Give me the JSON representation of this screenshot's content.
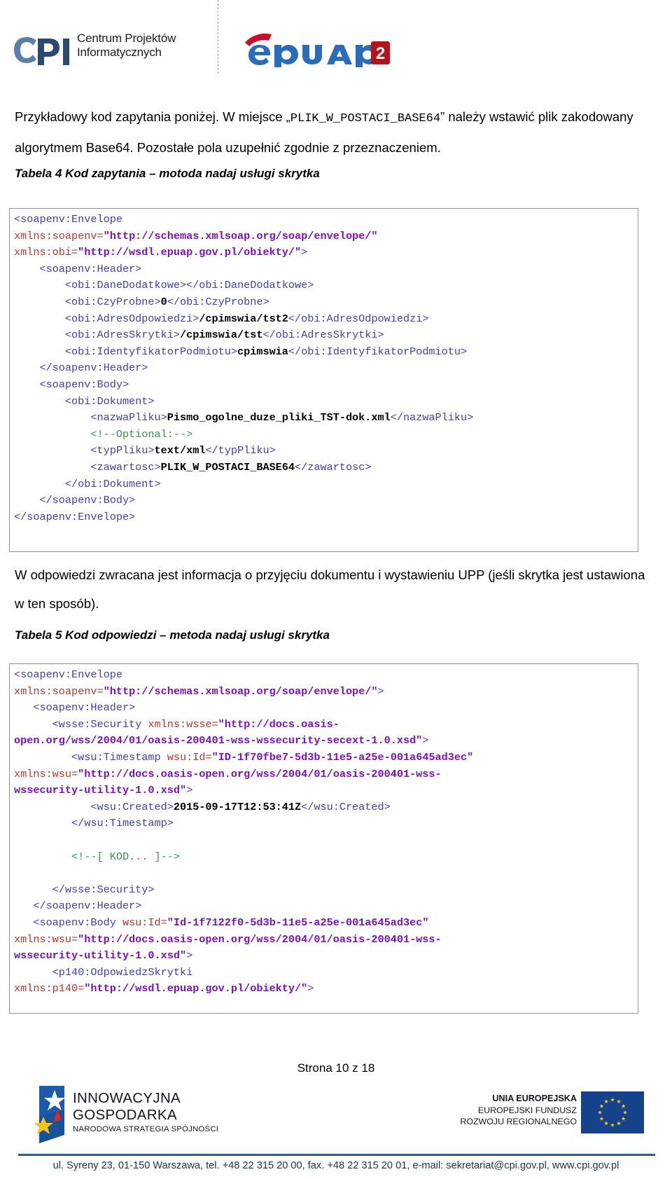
{
  "header": {
    "cpi_logo_line1": "Centrum Projektów",
    "cpi_logo_line2": "Informatycznych",
    "cpi_mark_text": "CPI",
    "epuap_wordmark": "ePUAP",
    "epuap_badge": "2"
  },
  "intro": {
    "part1": "Przykładowy kod zapytania poniżej. W miejsce „",
    "code": "PLIK_W_POSTACI_BASE64",
    "part2": "” należy wstawić plik zakodowany algorytmem Base64. Pozostałe pola uzupełnić zgodnie z przeznaczeniem."
  },
  "caption_tabela4": "Tabela 4 Kod zapytania – motoda nadaj usługi skrytka",
  "caption_tabela5": "Tabela 5 Kod odpowiedzi – metoda nadaj usługi skrytka",
  "mid_para": "W odpowiedzi zwracana jest informacja o przyjęciu dokumentu i wystawieniu UPP (jeśli skrytka jest ustawiona w ten sposób).",
  "code_request": {
    "lines": [
      [
        [
          "tag",
          "<soapenv:Envelope"
        ]
      ],
      [
        [
          "attr",
          "xmlns:soapenv="
        ],
        [
          "val",
          "\"http://schemas.xmlsoap.org/soap/envelope/\""
        ]
      ],
      [
        [
          "attr",
          "xmlns:obi="
        ],
        [
          "val",
          "\"http://wsdl.epuap.gov.pl/obiekty/\""
        ],
        [
          "tag",
          ">"
        ]
      ],
      [
        [
          "tag",
          "    <soapenv:Header>"
        ]
      ],
      [
        [
          "tag",
          "        <obi:DaneDodatkowe></obi:DaneDodatkowe>"
        ]
      ],
      [
        [
          "tag",
          "        <obi:CzyProbne>"
        ],
        [
          "text",
          "0"
        ],
        [
          "tag",
          "</obi:CzyProbne>"
        ]
      ],
      [
        [
          "tag",
          "        <obi:AdresOdpowiedzi>"
        ],
        [
          "text",
          "/cpimswia/tst2"
        ],
        [
          "tag",
          "</obi:AdresOdpowiedzi>"
        ]
      ],
      [
        [
          "tag",
          "        <obi:AdresSkrytki>"
        ],
        [
          "text",
          "/cpimswia/tst"
        ],
        [
          "tag",
          "</obi:AdresSkrytki>"
        ]
      ],
      [
        [
          "tag",
          "        <obi:IdentyfikatorPodmiotu>"
        ],
        [
          "text",
          "cpimswia"
        ],
        [
          "tag",
          "</obi:IdentyfikatorPodmiotu>"
        ]
      ],
      [
        [
          "tag",
          "    </soapenv:Header>"
        ]
      ],
      [
        [
          "tag",
          "    <soapenv:Body>"
        ]
      ],
      [
        [
          "tag",
          "        <obi:Dokument>"
        ]
      ],
      [
        [
          "tag",
          "            <nazwaPliku>"
        ],
        [
          "text",
          "Pismo_ogolne_duze_pliki_TST-dok.xml"
        ],
        [
          "tag",
          "</nazwaPliku>"
        ]
      ],
      [
        [
          "cmt",
          "            <!--Optional:-->"
        ]
      ],
      [
        [
          "tag",
          "            <typPliku>"
        ],
        [
          "text",
          "text/xml"
        ],
        [
          "tag",
          "</typPliku>"
        ]
      ],
      [
        [
          "tag",
          "            <zawartosc>"
        ],
        [
          "text",
          "PLIK_W_POSTACI_BASE64"
        ],
        [
          "tag",
          "</zawartosc>"
        ]
      ],
      [
        [
          "tag",
          "        </obi:Dokument>"
        ]
      ],
      [
        [
          "tag",
          "    </soapenv:Body>"
        ]
      ],
      [
        [
          "tag",
          "</soapenv:Envelope>"
        ]
      ]
    ]
  },
  "code_response": {
    "lines": [
      [
        [
          "tag",
          "<soapenv:Envelope"
        ]
      ],
      [
        [
          "attr",
          "xmlns:soapenv="
        ],
        [
          "val",
          "\"http://schemas.xmlsoap.org/soap/envelope/\""
        ],
        [
          "tag",
          ">"
        ]
      ],
      [
        [
          "tag",
          "   <soapenv:Header>"
        ]
      ],
      [
        [
          "tag",
          "      <wsse:Security "
        ],
        [
          "attr",
          "xmlns:wsse="
        ],
        [
          "val",
          "\"http://docs.oasis-"
        ]
      ],
      [
        [
          "val",
          "open.org/wss/2004/01/oasis-200401-wss-wssecurity-secext-1.0.xsd\""
        ],
        [
          "tag",
          ">"
        ]
      ],
      [
        [
          "tag",
          "         <wsu:Timestamp "
        ],
        [
          "attr",
          "wsu:Id="
        ],
        [
          "val",
          "\"ID-1f70fbe7-5d3b-11e5-a25e-001a645ad3ec\""
        ]
      ],
      [
        [
          "attr",
          "xmlns:wsu="
        ],
        [
          "val",
          "\"http://docs.oasis-open.org/wss/2004/01/oasis-200401-wss-"
        ]
      ],
      [
        [
          "val",
          "wssecurity-utility-1.0.xsd\""
        ],
        [
          "tag",
          ">"
        ]
      ],
      [
        [
          "tag",
          "            <wsu:Created>"
        ],
        [
          "text",
          "2015-09-17T12:53:41Z"
        ],
        [
          "tag",
          "</wsu:Created>"
        ]
      ],
      [
        [
          "tag",
          "         </wsu:Timestamp>"
        ]
      ],
      [
        [
          "tag",
          ""
        ]
      ],
      [
        [
          "cmt",
          "         <!--[ KOD... ]-->"
        ]
      ],
      [
        [
          "tag",
          ""
        ]
      ],
      [
        [
          "tag",
          "      </wsse:Security>"
        ]
      ],
      [
        [
          "tag",
          "   </soapenv:Header>"
        ]
      ],
      [
        [
          "tag",
          "   <soapenv:Body "
        ],
        [
          "attr",
          "wsu:Id="
        ],
        [
          "val",
          "\"Id-1f7122f0-5d3b-11e5-a25e-001a645ad3ec\""
        ]
      ],
      [
        [
          "attr",
          "xmlns:wsu="
        ],
        [
          "val",
          "\"http://docs.oasis-open.org/wss/2004/01/oasis-200401-wss-"
        ]
      ],
      [
        [
          "val",
          "wssecurity-utility-1.0.xsd\""
        ],
        [
          "tag",
          ">"
        ]
      ],
      [
        [
          "tag",
          "      <p140:OdpowiedzSkrytki"
        ]
      ],
      [
        [
          "attr",
          "xmlns:p140="
        ],
        [
          "val",
          "\"http://wsdl.epuap.gov.pl/obiekty/\""
        ],
        [
          "tag",
          ">"
        ]
      ]
    ]
  },
  "footer": {
    "page_number": "Strona 10 z 18",
    "ig_line1": "INNOWACYJNA",
    "ig_line2": "GOSPODARKA",
    "ig_line3": "NARODOWA STRATEGIA SPÓJNOŚCI",
    "eu_line1": "UNIA EUROPEJSKA",
    "eu_line2": "EUROPEJSKI FUNDUSZ",
    "eu_line3": "ROZWOJU REGIONALNEGO",
    "contact": "ul. Syreny 23, 01-150 Warszawa, tel. +48 22 315 20 00, fax. +48 22 315 20 01, e-mail: sekretariat@cpi.gov.pl, www.cpi.gov.pl"
  },
  "colors": {
    "tag": "#3f3fb0",
    "attr": "#b03a2e",
    "value": "#7912b8",
    "comment": "#3f8f52",
    "footer_rule": "#2e5f8a",
    "eu_blue": "#15428b",
    "epuap_blue": "#2b6cb8",
    "epuap_red": "#b5121b"
  }
}
